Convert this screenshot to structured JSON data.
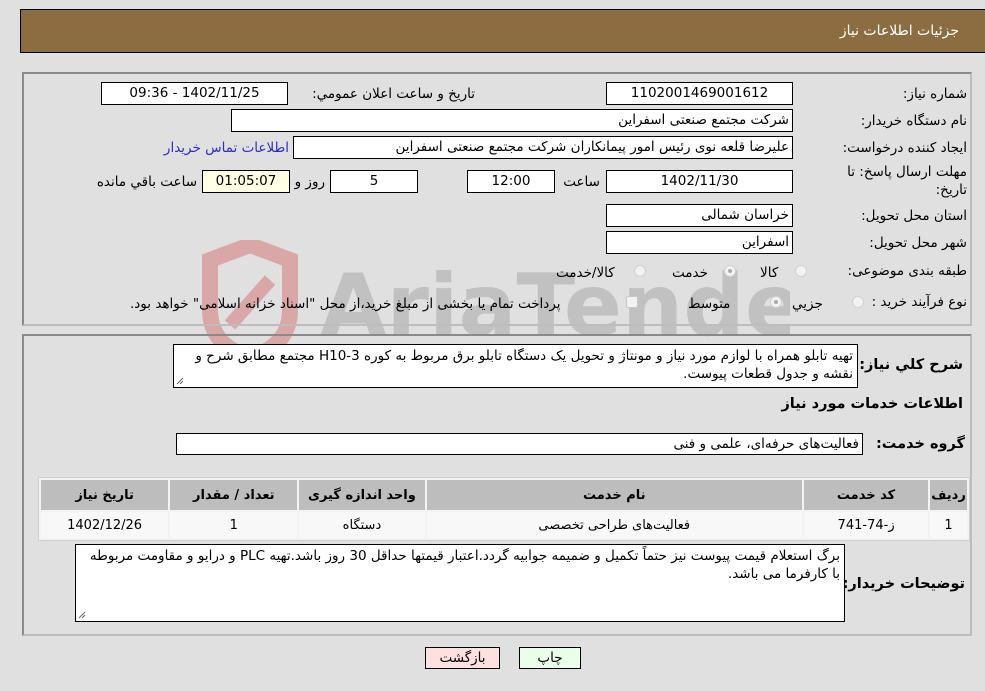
{
  "header": {
    "title": "جزئیات اطلاعات نیاز"
  },
  "fields": {
    "need_number": {
      "label": "شماره نیاز:",
      "value": "1102001469001612"
    },
    "announce_datetime": {
      "label": "تاریخ و ساعت اعلان عمومي:",
      "value": "1402/11/25 - 09:36"
    },
    "buyer_org": {
      "label": "نام دستگاه خریدار:",
      "value": "شرکت مجتمع صنعتی اسفراین"
    },
    "requester": {
      "label": "ایجاد کننده درخواست:",
      "value": "علیرضا قلعه نوی رئیس امور پیمانکاران شرکت مجتمع صنعتی اسفراین"
    },
    "buyer_contact_link": "اطلاعات تماس خریدار",
    "deadline": {
      "label_line1": "مهلت ارسال پاسخ: تا",
      "label_line2": "تاریخ:",
      "date": "1402/11/30",
      "time_label": "ساعت",
      "time": "12:00",
      "days": "5",
      "days_label": "روز و",
      "remaining": "01:05:07",
      "remaining_label": "ساعت باقي مانده"
    },
    "province": {
      "label": "استان محل تحویل:",
      "value": "خراسان شمالی"
    },
    "city": {
      "label": "شهر محل تحویل:",
      "value": "اسفراین"
    },
    "category": {
      "label": "طبقه بندی موضوعی:",
      "options": [
        "کالا",
        "خدمت",
        "کالا/خدمت"
      ],
      "selected": "خدمت"
    },
    "purchase_type": {
      "label": "نوع فرآیند خرید :",
      "options": [
        "جزيي",
        "متوسط"
      ],
      "selected": "متوسط",
      "treasury_note": "پرداخت تمام یا بخشی از مبلغ خرید،از محل \"اسناد خزانه اسلامی\" خواهد بود."
    }
  },
  "description": {
    "label": "شرح کلي نیاز:",
    "value": "تهیه تابلو همراه با لوازم مورد نیاز و مونتاژ و تحویل یک دستگاه تابلو برق مربوط به کوره H10-3 مجتمع مطابق شرح و نقشه و جدول قطعات پیوست."
  },
  "services_section": {
    "title": "اطلاعات خدمات مورد نیاز",
    "group_label": "گروه خدمت:",
    "group_value": "فعالیت‌های حرفه‌ای، علمی و فنی",
    "table": {
      "headers": [
        "ردیف",
        "کد خدمت",
        "نام خدمت",
        "واحد اندازه گیری",
        "تعداد / مقدار",
        "تاریخ نیاز"
      ],
      "rows": [
        [
          "1",
          "ز-74-741",
          "فعالیت‌های طراحی تخصصی",
          "دستگاه",
          "1",
          "1402/12/26"
        ]
      ]
    }
  },
  "buyer_notes": {
    "label": "توضیحات خریدار:",
    "value": "برگ استعلام قیمت پیوست نیز حتماً تکمیل و ضمیمه جوابیه گردد.اعتبار قیمتها حداقل 30 روز باشد.تهیه PLC و درایو و مقاومت مربوطه با کارفرما می باشد."
  },
  "buttons": {
    "print": "چاپ",
    "back": "بازگشت"
  },
  "watermark": {
    "text": "AriaTender.neT"
  },
  "colors": {
    "header_bg": "#8c6d42",
    "print_bg": "#eaffea",
    "back_bg": "#ffe0e0",
    "link": "#2c2cc8"
  }
}
